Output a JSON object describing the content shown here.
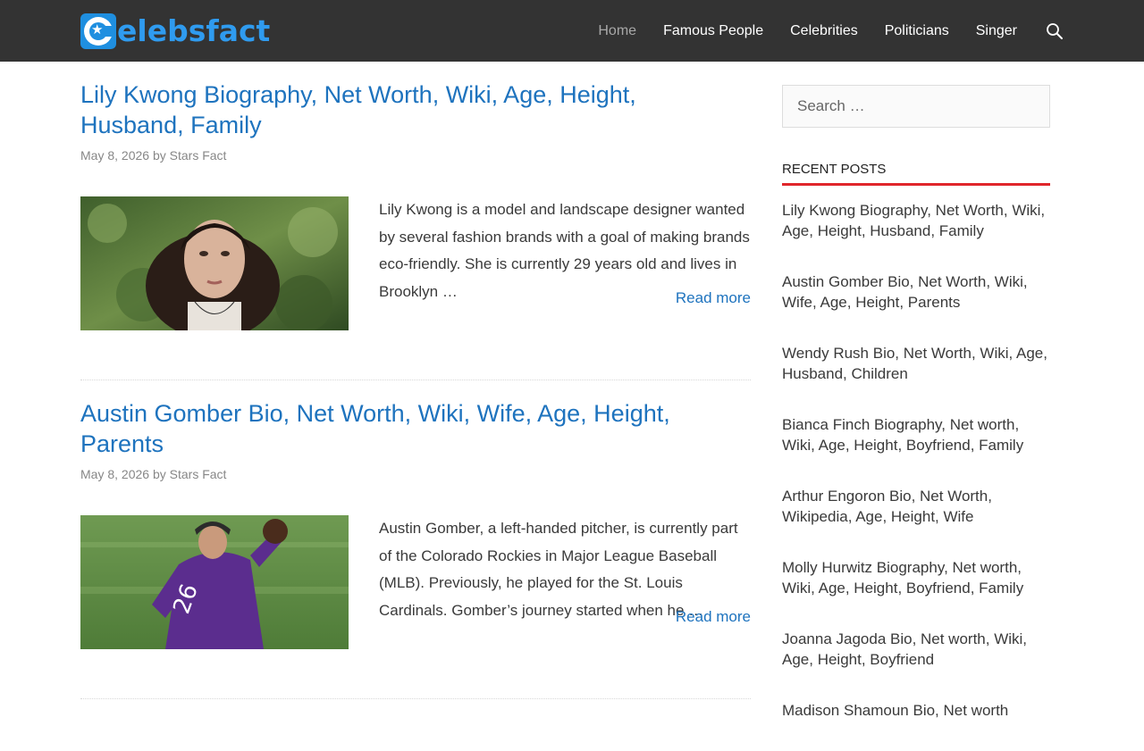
{
  "header": {
    "logo_text": "elebsfact",
    "logo_alt": "Celebsfact",
    "nav": [
      {
        "label": "Home"
      },
      {
        "label": "Famous People"
      },
      {
        "label": "Celebrities"
      },
      {
        "label": "Politicians"
      },
      {
        "label": "Singer"
      }
    ]
  },
  "posts": [
    {
      "title": "Lily Kwong Biography, Net Worth, Wiki, Age, Height, Husband, Family",
      "date": "May 8, 2026",
      "by": "by",
      "author": "Stars Fact",
      "excerpt": "Lily Kwong is a model and landscape designer wanted by several fashion brands with a goal of making brands eco-friendly. She is currently 29 years old and lives in Brooklyn …",
      "read_more": "Read more"
    },
    {
      "title": "Austin Gomber Bio, Net Worth, Wiki, Wife, Age, Height, Parents",
      "date": "May 8, 2026",
      "by": "by",
      "author": "Stars Fact",
      "excerpt": "Austin Gomber, a left-handed pitcher, is currently part of the Colorado Rockies in Major League Baseball (MLB). Previously, he played for the St. Louis Cardinals. Gomber’s journey started when he …",
      "read_more": "Read more"
    }
  ],
  "sidebar": {
    "search_placeholder": "Search …",
    "recent_title": "Recent Posts",
    "recent_posts": [
      "Lily Kwong Biography, Net Worth, Wiki, Age, Height, Husband, Family",
      "Austin Gomber Bio, Net Worth, Wiki, Wife, Age, Height, Parents",
      "Wendy Rush Bio, Net Worth, Wiki, Age, Husband, Children",
      "Bianca Finch Biography, Net worth, Wiki, Age, Height, Boyfriend, Family",
      "Arthur Engoron Bio, Net Worth, Wikipedia, Age, Height, Wife",
      "Molly Hurwitz Biography, Net worth, Wiki, Age, Height, Boyfriend, Family",
      "Joanna Jagoda Bio, Net worth, Wiki, Age, Height, Boyfriend",
      "Madison Shamoun Bio, Net worth"
    ]
  },
  "colors": {
    "header_bg": "#333333",
    "link": "#1e73be",
    "accent_red": "#e0262b",
    "logo_blue": "#2f9bef"
  },
  "icons": {
    "search": "search-icon",
    "logo": "celebsfact-logo-icon"
  }
}
